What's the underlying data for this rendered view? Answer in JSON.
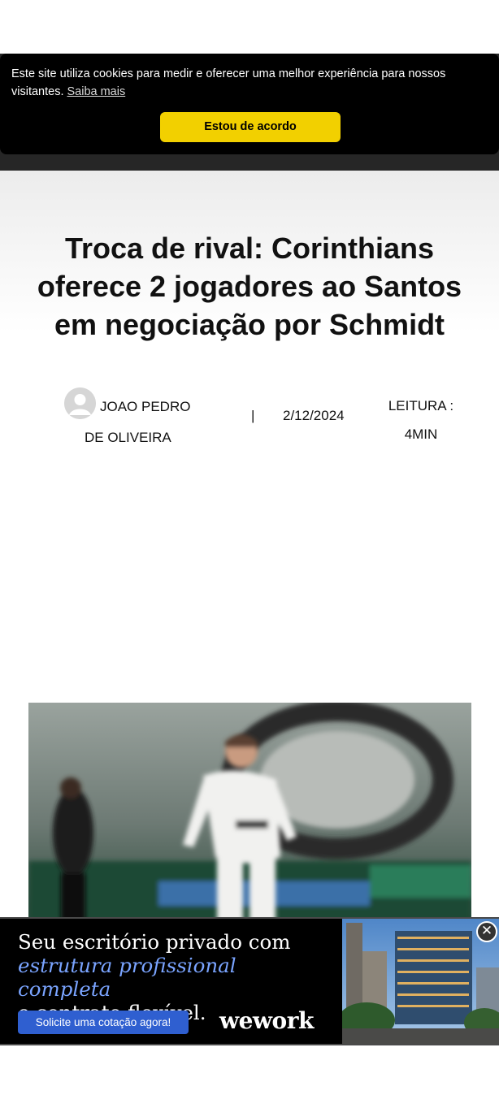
{
  "cookie_banner": {
    "message": "Este site utiliza cookies para medir e oferecer uma melhor experiência para nossos visitantes.",
    "link_label": "Saiba mais",
    "accept_label": "Estou de acordo"
  },
  "article": {
    "title": "Troca de rival: Corinthians oferece 2 jogadores ao Santos em negociação por Schmidt",
    "author_line1": "JOAO PEDRO",
    "author_line2": "DE OLIVEIRA",
    "separator": "|",
    "date": "2/12/2024",
    "reading_line1": "LEITURA :",
    "reading_line2": "4MIN",
    "image_icon": "article-photo"
  },
  "ad": {
    "line1": "Seu escritório privado com",
    "line2": "estrutura profissional completa",
    "line3": "e contrato flexível.",
    "cta_label": "Solicite uma cotação agora!",
    "brand": "wework",
    "close_label": "✕",
    "accent_color": "#7aa4ff",
    "button_color": "#2f5fd0"
  },
  "colors": {
    "cookie_button": "#f2d000",
    "header_bg": "#262626"
  }
}
